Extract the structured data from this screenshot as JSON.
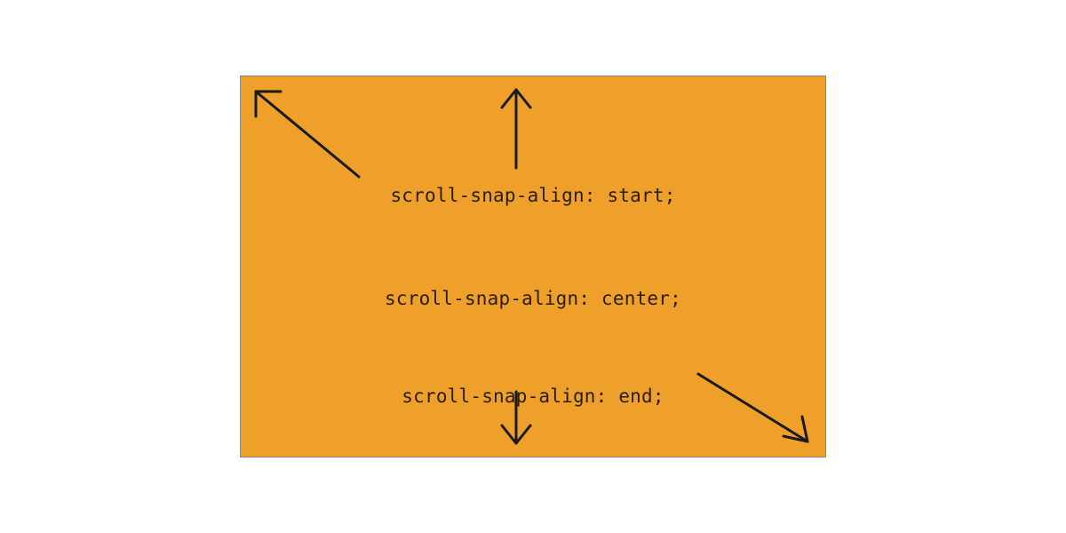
{
  "diagram": {
    "background_color": "#eea02b",
    "border_color": "#888888",
    "labels": {
      "start": "scroll-snap-align: start;",
      "center": "scroll-snap-align: center;",
      "end": "scroll-snap-align: end;"
    },
    "arrows": [
      {
        "name": "top-left-arrow",
        "direction": "northwest"
      },
      {
        "name": "top-center-arrow",
        "direction": "north"
      },
      {
        "name": "bottom-center-arrow",
        "direction": "south"
      },
      {
        "name": "bottom-right-arrow",
        "direction": "southeast"
      }
    ]
  }
}
